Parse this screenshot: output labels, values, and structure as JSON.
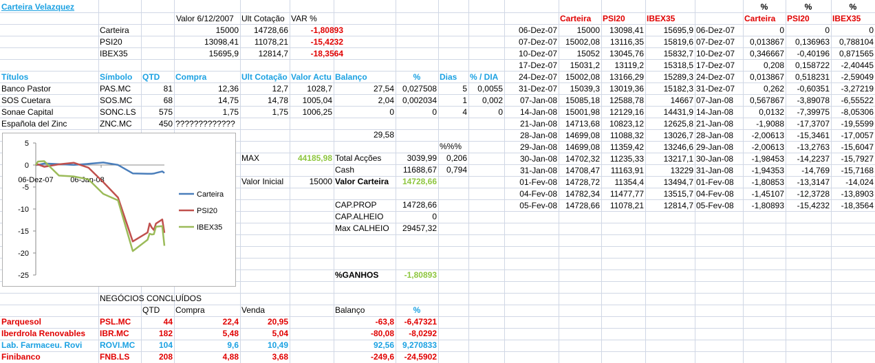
{
  "title": "Carteira Velazquez",
  "summary": {
    "headers": [
      "Valor 6/12/2007",
      "Ult Cotação",
      "VAR %"
    ],
    "rows": [
      {
        "name": "Carteira",
        "valor": "15000",
        "ult": "14728,66",
        "var": "-1,80893"
      },
      {
        "name": "PSI20",
        "valor": "13098,41",
        "ult": "11078,21",
        "var": "-15,4232"
      },
      {
        "name": "IBEX35",
        "valor": "15695,9",
        "ult": "12814,7",
        "var": "-18,3564"
      }
    ]
  },
  "holdings": {
    "headers": [
      "Títulos",
      "Símbolo",
      "QTD",
      "Compra",
      "Ult Cotação",
      "Valor Actu",
      "Balanço",
      "%",
      "Dias",
      "% / DIA"
    ],
    "rows": [
      {
        "titulo": "Banco Pastor",
        "simbolo": "PAS.MC",
        "qtd": "81",
        "compra": "12,36",
        "ult": "12,7",
        "valor": "1028,7",
        "balanco": "27,54",
        "pct": "0,027508",
        "dias": "5",
        "pdia": "0,0055"
      },
      {
        "titulo": "SOS Cuetara",
        "simbolo": "SOS.MC",
        "qtd": "68",
        "compra": "14,75",
        "ult": "14,78",
        "valor": "1005,04",
        "balanco": "2,04",
        "pct": "0,002034",
        "dias": "1",
        "pdia": "0,002"
      },
      {
        "titulo": "Sonae Capital",
        "simbolo": "SONC.LS",
        "qtd": "575",
        "compra": "1,75",
        "ult": "1,75",
        "valor": "1006,25",
        "balanco": "0",
        "pct": "0",
        "dias": "4",
        "pdia": "0"
      },
      {
        "titulo": "Española del Zinc",
        "simbolo": "ZNC.MC",
        "qtd": "450",
        "compra": "?????????????",
        "ult": "",
        "valor": "",
        "balanco": "",
        "pct": "",
        "dias": "",
        "pdia": ""
      }
    ],
    "balanco_total": "29,58",
    "pct_header": "%%%"
  },
  "stats": {
    "max_label": "MAX",
    "max_value": "44185,98",
    "valor_inicial_label": "Valor Inicial",
    "valor_inicial": "15000",
    "total_accoes_label": "Total Acções",
    "total_accoes": "3039,99",
    "total_accoes_pct": "0,206",
    "cash_label": "Cash",
    "cash": "11688,67",
    "cash_pct": "0,794",
    "valor_carteira_label": "Valor Carteira",
    "valor_carteira": "14728,66",
    "cap_prop_label": "CAP.PROP",
    "cap_prop": "14728,66",
    "cap_alheio_label": "CAP.ALHEIO",
    "cap_alheio": "0",
    "max_calheio_label": "Max CALHEIO",
    "max_calheio": "29457,32",
    "ganhos_label": "%GANHOS",
    "ganhos": "-1,80893"
  },
  "concluded": {
    "title": "NEGÓCIOS CONCLUÍDOS",
    "headers": [
      "QTD",
      "Compra",
      "Venda",
      "Balanço",
      "%"
    ],
    "rows": [
      {
        "titulo": "Parquesol",
        "simbolo": "PSL.MC",
        "qtd": "44",
        "compra": "22,4",
        "venda": "20,95",
        "balanco": "-63,8",
        "pct": "-6,47321",
        "color": "red"
      },
      {
        "titulo": "Iberdrola Renovables",
        "simbolo": "IBR.MC",
        "qtd": "182",
        "compra": "5,48",
        "venda": "5,04",
        "balanco": "-80,08",
        "pct": "-8,0292",
        "color": "red"
      },
      {
        "titulo": "Lab. Farmaceu. Rovi",
        "simbolo": "ROVI.MC",
        "qtd": "104",
        "compra": "9,6",
        "venda": "10,49",
        "balanco": "92,56",
        "pct": "9,270833",
        "color": "blue"
      },
      {
        "titulo": "Finibanco",
        "simbolo": "FNB.LS",
        "qtd": "208",
        "compra": "4,88",
        "venda": "3,68",
        "balanco": "-249,6",
        "pct": "-24,5902",
        "color": "red"
      }
    ]
  },
  "history": {
    "headers": [
      "Carteira",
      "PSI20",
      "IBEX35"
    ],
    "pct_headers": [
      "%",
      "%",
      "%"
    ],
    "pct_col_headers": [
      "Carteira",
      "PSI20",
      "IBEX35"
    ],
    "rows": [
      {
        "date": "06-Dez-07",
        "carteira": "15000",
        "psi20": "13098,41",
        "ibex35": "15695,9",
        "date2": "06-Dez-07",
        "pc": "0",
        "pp": "0",
        "pi": "0"
      },
      {
        "date": "07-Dez-07",
        "carteira": "15002,08",
        "psi20": "13116,35",
        "ibex35": "15819,6",
        "date2": "07-Dez-07",
        "pc": "0,013867",
        "pp": "0,136963",
        "pi": "0,788104"
      },
      {
        "date": "10-Dez-07",
        "carteira": "15052",
        "psi20": "13045,76",
        "ibex35": "15832,7",
        "date2": "10-Dez-07",
        "pc": "0,346667",
        "pp": "-0,40196",
        "pi": "0,871565"
      },
      {
        "date": "17-Dez-07",
        "carteira": "15031,2",
        "psi20": "13119,2",
        "ibex35": "15318,5",
        "date2": "17-Dez-07",
        "pc": "0,208",
        "pp": "0,158722",
        "pi": "-2,40445"
      },
      {
        "date": "24-Dez-07",
        "carteira": "15002,08",
        "psi20": "13166,29",
        "ibex35": "15289,3",
        "date2": "24-Dez-07",
        "pc": "0,013867",
        "pp": "0,518231",
        "pi": "-2,59049"
      },
      {
        "date": "31-Dez-07",
        "carteira": "15039,3",
        "psi20": "13019,36",
        "ibex35": "15182,3",
        "date2": "31-Dez-07",
        "pc": "0,262",
        "pp": "-0,60351",
        "pi": "-3,27219"
      },
      {
        "date": "07-Jan-08",
        "carteira": "15085,18",
        "psi20": "12588,78",
        "ibex35": "14667",
        "date2": "07-Jan-08",
        "pc": "0,567867",
        "pp": "-3,89078",
        "pi": "-6,55522"
      },
      {
        "date": "14-Jan-08",
        "carteira": "15001,98",
        "psi20": "12129,16",
        "ibex35": "14431,9",
        "date2": "14-Jan-08",
        "pc": "0,0132",
        "pp": "-7,39975",
        "pi": "-8,05306"
      },
      {
        "date": "21-Jan-08",
        "carteira": "14713,68",
        "psi20": "10823,12",
        "ibex35": "12625,8",
        "date2": "21-Jan-08",
        "pc": "-1,9088",
        "pp": "-17,3707",
        "pi": "-19,5599"
      },
      {
        "date": "28-Jan-08",
        "carteira": "14699,08",
        "psi20": "11088,32",
        "ibex35": "13026,7",
        "date2": "28-Jan-08",
        "pc": "-2,00613",
        "pp": "-15,3461",
        "pi": "-17,0057"
      },
      {
        "date": "29-Jan-08",
        "carteira": "14699,08",
        "psi20": "11359,42",
        "ibex35": "13246,6",
        "date2": "29-Jan-08",
        "pc": "-2,00613",
        "pp": "-13,2763",
        "pi": "-15,6047"
      },
      {
        "date": "30-Jan-08",
        "carteira": "14702,32",
        "psi20": "11235,33",
        "ibex35": "13217,1",
        "date2": "30-Jan-08",
        "pc": "-1,98453",
        "pp": "-14,2237",
        "pi": "-15,7927"
      },
      {
        "date": "31-Jan-08",
        "carteira": "14708,47",
        "psi20": "11163,91",
        "ibex35": "13229",
        "date2": "31-Jan-08",
        "pc": "-1,94353",
        "pp": "-14,769",
        "pi": "-15,7168"
      },
      {
        "date": "01-Fev-08",
        "carteira": "14728,72",
        "psi20": "11354,4",
        "ibex35": "13494,7",
        "date2": "01-Fev-08",
        "pc": "-1,80853",
        "pp": "-13,3147",
        "pi": "-14,024"
      },
      {
        "date": "04-Fev-08",
        "carteira": "14782,34",
        "psi20": "11477,77",
        "ibex35": "13515,7",
        "date2": "04-Fev-08",
        "pc": "-1,45107",
        "pp": "-12,3728",
        "pi": "-13,8903"
      },
      {
        "date": "05-Fev-08",
        "carteira": "14728,66",
        "psi20": "11078,21",
        "ibex35": "12814,7",
        "date2": "05-Fev-08",
        "pc": "-1,80893",
        "pp": "-15,4232",
        "pi": "-18,3564"
      }
    ]
  },
  "chart_data": {
    "type": "line",
    "x": [
      "06-Dez-07",
      "07-Dez-07",
      "10-Dez-07",
      "17-Dez-07",
      "24-Dez-07",
      "31-Dez-07",
      "07-Jan-08",
      "14-Jan-08",
      "21-Jan-08",
      "28-Jan-08",
      "29-Jan-08",
      "30-Jan-08",
      "31-Jan-08",
      "01-Fev-08",
      "04-Fev-08",
      "05-Fev-08"
    ],
    "x_tick_labels": [
      "06-Dez-07",
      "06-Jan-08"
    ],
    "series": [
      {
        "name": "Carteira",
        "color": "#4a7ebb",
        "values": [
          0,
          0.013867,
          0.346667,
          0.208,
          0.013867,
          0.262,
          0.567867,
          0.0132,
          -1.9088,
          -2.00613,
          -2.00613,
          -1.98453,
          -1.94353,
          -1.80853,
          -1.45107,
          -1.80893
        ]
      },
      {
        "name": "PSI20",
        "color": "#c0504d",
        "values": [
          0,
          0.136963,
          -0.40196,
          0.158722,
          0.518231,
          -0.60351,
          -3.89078,
          -7.39975,
          -17.3707,
          -15.3461,
          -13.2763,
          -14.2237,
          -14.769,
          -13.3147,
          -12.3728,
          -15.4232
        ]
      },
      {
        "name": "IBEX35",
        "color": "#9bbb59",
        "values": [
          0,
          0.788104,
          0.871565,
          -2.40445,
          -2.59049,
          -3.27219,
          -6.55522,
          -8.05306,
          -19.5599,
          -17.0057,
          -15.6047,
          -15.7927,
          -15.7168,
          -14.024,
          -13.8903,
          -18.3564
        ]
      }
    ],
    "ylim": [
      -25,
      5
    ],
    "y_ticks": [
      "5",
      "0",
      "-5",
      "-10",
      "-15",
      "-20",
      "-25"
    ],
    "legend": "right",
    "grid": true
  }
}
